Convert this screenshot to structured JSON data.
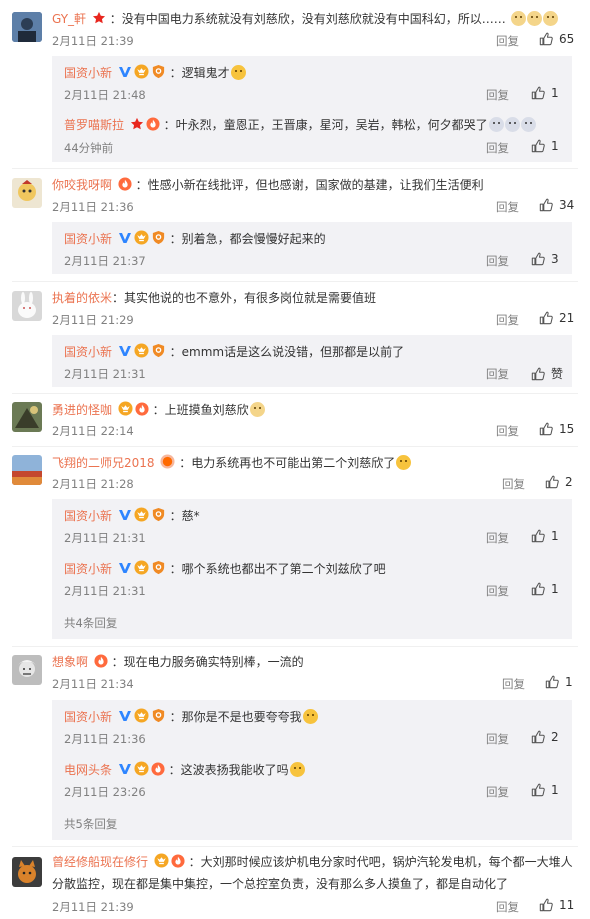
{
  "icons": {
    "verified": "verified-v-icon",
    "vip": "vip-crown-icon",
    "star": "star-icon",
    "flame": "flame-badge-icon",
    "thumb": "thumb-up-icon"
  },
  "colors": {
    "username": "#eb7350",
    "meta": "#808080",
    "panel": "#f2f2f5",
    "verified": "#2e85ff"
  },
  "reply_label": "回复",
  "comments": [
    {
      "user": "GY_軒",
      "text": "：没有中国电力系统就没有刘慈欣，没有刘慈欣就没有中国科幻，所以……",
      "time": "2月11日 21:39",
      "likes": "65",
      "replies": [
        {
          "user": "国资小新",
          "text": "：逻辑鬼才",
          "time": "2月11日 21:48",
          "likes": "1"
        },
        {
          "user": "普罗喵斯拉",
          "text": "：叶永烈，童恩正，王晋康，星河，吴岩，韩松，何夕都哭了",
          "time": "44分钟前",
          "likes": "1"
        }
      ]
    },
    {
      "user": "你咬我呀啊",
      "text": "：性感小新在线批评，但也感谢，国家做的基建，让我们生活便利",
      "time": "2月11日 21:36",
      "likes": "34",
      "replies": [
        {
          "user": "国资小新",
          "text": "：别着急，都会慢慢好起来的",
          "time": "2月11日 21:37",
          "likes": "3"
        }
      ]
    },
    {
      "user": "执着的依米",
      "text": "：其实他说的也不意外，有很多岗位就是需要值班",
      "time": "2月11日 21:29",
      "likes": "21",
      "replies": [
        {
          "user": "国资小新",
          "text": "：emmm话是这么说没错，但那都是以前了",
          "time": "2月11日 21:31",
          "likes": "赞"
        }
      ]
    },
    {
      "user": "勇进的怪咖",
      "text": "：上班摸鱼刘慈欣",
      "time": "2月11日 22:14",
      "likes": "15",
      "replies": []
    },
    {
      "user": "飞翔的二师兄2018",
      "text": "：电力系统再也不可能出第二个刘慈欣了",
      "time": "2月11日 21:28",
      "likes": "2",
      "replies": [
        {
          "user": "国资小新",
          "text": "：慈*",
          "time": "2月11日 21:31",
          "likes": "1"
        },
        {
          "user": "国资小新",
          "text": "：哪个系统也都出不了第二个刘兹欣了吧",
          "time": "2月11日 21:31",
          "likes": "1"
        }
      ],
      "more": "共4条回复"
    },
    {
      "user": "想象啊",
      "text": "：现在电力服务确实特别棒，一流的",
      "time": "2月11日 21:34",
      "likes": "1",
      "replies": [
        {
          "user": "国资小新",
          "text": "：那你是不是也要夸夸我",
          "time": "2月11日 21:36",
          "likes": "2"
        },
        {
          "user": "电网头条",
          "text": "：这波表扬我能收了吗",
          "time": "2月11日 23:26",
          "likes": "1"
        }
      ],
      "more": "共5条回复"
    },
    {
      "user": "曾经修船现在修行",
      "text": "：大刘那时候应该炉机电分家时代吧，锅炉汽轮发电机，每个都一大堆人",
      "text2": "分散监控，现在都是集中集控，一个总控室负责，没有那么多人摸鱼了，都是自动化了",
      "time": "2月11日 21:39",
      "likes": "11",
      "replies": []
    }
  ]
}
